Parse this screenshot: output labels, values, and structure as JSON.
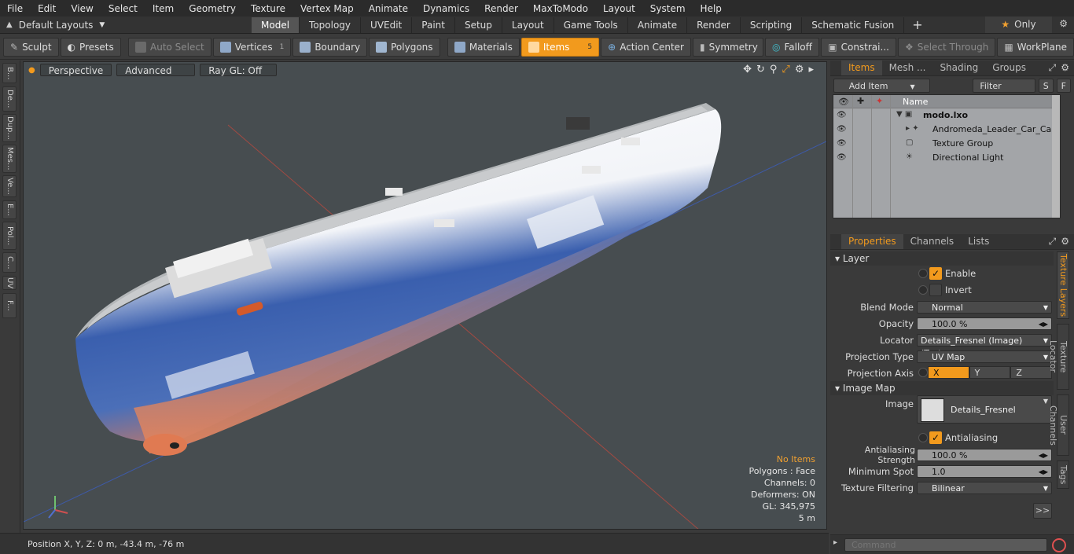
{
  "menu": [
    "File",
    "Edit",
    "View",
    "Select",
    "Item",
    "Geometry",
    "Texture",
    "Vertex Map",
    "Animate",
    "Dynamics",
    "Render",
    "MaxToModo",
    "Layout",
    "System",
    "Help"
  ],
  "layouts": {
    "label": "Default Layouts"
  },
  "tabs": [
    "Model",
    "Topology",
    "UVEdit",
    "Paint",
    "Setup",
    "Layout",
    "Game Tools",
    "Animate",
    "Render",
    "Scripting",
    "Schematic Fusion"
  ],
  "only_label": "Only",
  "toolbar": {
    "sculpt": "Sculpt",
    "presets": "Presets",
    "auto_select": "Auto Select",
    "vertices": "Vertices",
    "vertices_count": "1",
    "boundary": "Boundary",
    "polygons": "Polygons",
    "materials": "Materials",
    "items": "Items",
    "items_count": "5",
    "action_center": "Action Center",
    "symmetry": "Symmetry",
    "falloff": "Falloff",
    "constraints": "Constrai...",
    "select_through": "Select Through",
    "workplane": "WorkPlane"
  },
  "left_tabs": [
    "B...",
    "De...",
    "Dup...",
    "Mes...",
    "Ve...",
    "E...",
    "Pol...",
    "C...",
    "UV",
    "F..."
  ],
  "viewport": {
    "view_mode": "Perspective",
    "shading": "Advanced",
    "raygl": "Ray GL: Off",
    "info": {
      "no_items": "No Items",
      "polygons": "Polygons : Face",
      "channels": "Channels: 0",
      "deformers": "Deformers: ON",
      "gl": "GL: 345,975",
      "scale": "5 m"
    }
  },
  "status": {
    "position": "Position X, Y, Z:   0 m, -43.4 m, -76 m"
  },
  "items_panel": {
    "tabs": [
      "Items",
      "Mesh ...",
      "Shading",
      "Groups"
    ],
    "add_item": "Add Item",
    "filter_items": "Filter Items",
    "s_btn": "S",
    "f_btn": "F",
    "name_col": "Name",
    "rows": [
      {
        "label": "modo.lxo"
      },
      {
        "label": "Andromeda_Leader_Car_Carri ..."
      },
      {
        "label": "Texture Group"
      },
      {
        "label": "Directional Light"
      }
    ]
  },
  "props_panel": {
    "tabs": [
      "Properties",
      "Channels",
      "Lists"
    ],
    "layer_section": "Layer",
    "enable": "Enable",
    "invert": "Invert",
    "blend_mode_label": "Blend Mode",
    "blend_mode": "Normal",
    "opacity_label": "Opacity",
    "opacity": "100.0 %",
    "locator_label": "Locator",
    "locator": "Details_Fresnel (Image) (Text...",
    "proj_type_label": "Projection Type",
    "proj_type": "UV Map",
    "proj_axis_label": "Projection Axis",
    "axes": [
      "X",
      "Y",
      "Z"
    ],
    "image_map_section": "Image Map",
    "image_label": "Image",
    "image": "Details_Fresnel",
    "antialiasing": "Antialiasing",
    "aa_strength_label": "Antialiasing Strength",
    "aa_strength": "100.0 %",
    "min_spot_label": "Minimum Spot",
    "min_spot": "1.0",
    "tex_filter_label": "Texture Filtering",
    "tex_filter": "Bilinear",
    "more": ">>"
  },
  "side_tabs": [
    "Texture Layers",
    "Texture Locator",
    "User Channels",
    "Tags"
  ],
  "command": {
    "placeholder": "Command"
  },
  "colors": {
    "accent": "#f29a1d",
    "hull_blue": "#3a5fae",
    "hull_red": "#e07a52"
  }
}
